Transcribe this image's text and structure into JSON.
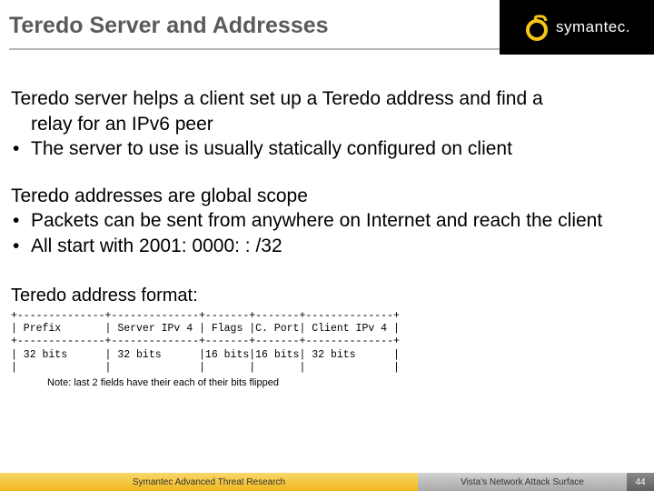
{
  "title": "Teredo Server and Addresses",
  "brand": {
    "name": "symantec."
  },
  "block1": {
    "lead_line1": "Teredo server helps a client set up a Teredo address and find a",
    "lead_line2": "relay for an IPv6 peer",
    "bullets": [
      "The server to use is usually statically configured on client"
    ]
  },
  "block2": {
    "lead": "Teredo addresses are global scope",
    "bullets": [
      "Packets can be sent from anywhere on Internet and reach the client",
      "All start with 2001: 0000: : /32"
    ]
  },
  "format": {
    "title": "Teredo address format:",
    "rows": [
      "+--------------+--------------+-------+-------+--------------+",
      "| Prefix       | Server IPv 4 | Flags |C. Port| Client IPv 4 |",
      "+--------------+--------------+-------+-------+--------------+",
      "| 32 bits      | 32 bits      |16 bits|16 bits| 32 bits      |",
      "|              |              |       |       |              |"
    ],
    "note": "Note: last 2 fields have their each of their bits flipped"
  },
  "footer": {
    "left": "Symantec Advanced Threat Research",
    "right": "Vista's Network Attack Surface",
    "page": "44"
  }
}
